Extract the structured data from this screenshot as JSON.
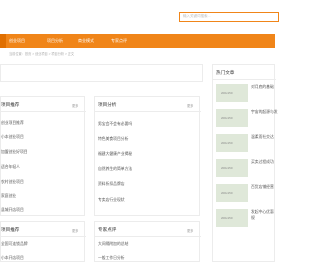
{
  "search": {
    "placeholder": "输入关键词搜索..."
  },
  "nav": {
    "items": [
      "",
      "创业项目",
      "项目分析",
      "商业模式",
      "专家点评"
    ],
    "active_index": 0,
    "accent": "#f08519"
  },
  "breadcrumb": "当前位置：首页 > 创业项目 > 项目分析 > 正文",
  "panels": [
    {
      "title": "项目推荐",
      "more": "更多",
      "rows": [
        "创业项目推荐",
        "小本创业项目",
        "加盟创业好项目",
        "适合年轻人",
        "农村创业项目",
        "家庭创业",
        "县城开店项目",
        "手机创业项目"
      ]
    },
    {
      "title": "项目分析",
      "more": "更多",
      "rows": [
        "男宝会不会有必要吗",
        "特色美食项目分析",
        "福建大健康产业揭秘",
        "自然养生的简单方法",
        "资料折扣品牌店",
        "专卖店行业现状",
        "竞争为什么变成创业"
      ]
    },
    {
      "title": "项目推荐",
      "more": "更多",
      "rows": [
        "全国可连锁品牌",
        "小本开店项目"
      ]
    },
    {
      "title": "专家点评",
      "more": "更多",
      "rows": [
        "大间隔附加的总结",
        "一般工作日分析"
      ]
    }
  ],
  "sidebar": {
    "title": "热门文章",
    "thumb_label": "200x150",
    "items": [
      {
        "line1": "对月底的基础",
        "line2": ""
      },
      {
        "line1": "宇宙的起源与发",
        "line2": ""
      },
      {
        "line1": "温柔而社交达",
        "line2": ""
      },
      {
        "line1": "买卖过程成功",
        "line2": ""
      },
      {
        "line1": "百货店铺经营",
        "line2": ""
      },
      {
        "line1": "发起中心优惠",
        "line2": "规"
      }
    ]
  }
}
